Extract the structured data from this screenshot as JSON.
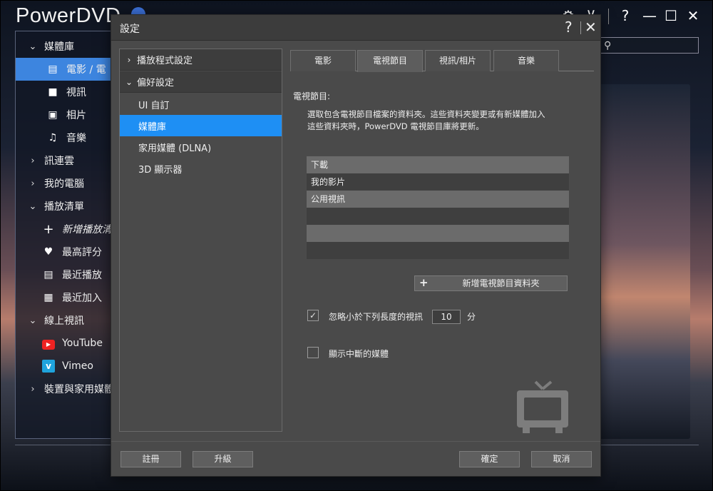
{
  "app": {
    "title": "PowerDVD",
    "window_controls": {
      "settings": "⚙",
      "minimize_tray": "⊻",
      "help": "?",
      "minimize": "—",
      "maximize": "☐",
      "close": "✕"
    }
  },
  "sidebar": {
    "items": [
      {
        "label": "媒體庫",
        "type": "section",
        "icon": "chevron-down-icon"
      },
      {
        "label": "電影 / 電",
        "type": "child",
        "icon": "film-icon",
        "selected": true
      },
      {
        "label": "視訊",
        "type": "child",
        "icon": "video-camera-icon"
      },
      {
        "label": "相片",
        "type": "child",
        "icon": "photo-icon"
      },
      {
        "label": "音樂",
        "type": "child",
        "icon": "music-note-icon"
      },
      {
        "label": "訊連雲",
        "type": "section",
        "icon": "chevron-right-icon"
      },
      {
        "label": "我的電腦",
        "type": "section",
        "icon": "chevron-right-icon"
      },
      {
        "label": "播放清單",
        "type": "section",
        "icon": "chevron-down-icon"
      },
      {
        "label": "新增播放清",
        "type": "child",
        "icon": "plus-icon",
        "italic": true
      },
      {
        "label": "最高評分",
        "type": "child",
        "icon": "heart-icon"
      },
      {
        "label": "最近播放",
        "type": "child",
        "icon": "recent-play-icon"
      },
      {
        "label": "最近加入",
        "type": "child",
        "icon": "recent-add-icon"
      },
      {
        "label": "線上視訊",
        "type": "section",
        "icon": "chevron-down-icon"
      },
      {
        "label": "YouTube",
        "type": "child",
        "icon": "youtube-icon"
      },
      {
        "label": "Vimeo",
        "type": "child",
        "icon": "vimeo-icon"
      },
      {
        "label": "裝置與家用媒體",
        "type": "section",
        "icon": "chevron-right-icon"
      }
    ]
  },
  "dialog": {
    "title": "設定",
    "help": "?",
    "close": "✕",
    "tree": {
      "player_settings": "播放程式設定",
      "preferences": "偏好設定",
      "ui_custom": "UI 自訂",
      "media_library": "媒體庫",
      "home_media": "家用媒體 (DLNA)",
      "display_3d": "3D 顯示器"
    },
    "tabs": [
      "電影",
      "電視節目",
      "視訊/相片",
      "音樂"
    ],
    "active_tab": "電視節目",
    "content": {
      "label": "電視節目:",
      "description_line1": "選取包含電視節目檔案的資料夾。這些資料夾變更或有新媒體加入",
      "description_line2": "這些資料夾時，PowerDVD 電視節目庫將更新。",
      "folders": [
        "下載",
        "我的影片",
        "公用視訊",
        "",
        "",
        ""
      ],
      "add_folder_button": "新增電視節目資料夾",
      "ignore_short_label": "忽略小於下列長度的視訊",
      "ignore_short_checked": true,
      "ignore_short_value": "10",
      "ignore_short_unit": "分",
      "show_interrupted_label": "顯示中斷的媒體",
      "show_interrupted_checked": false
    },
    "buttons": {
      "register": "註冊",
      "upgrade": "升級",
      "ok": "確定",
      "cancel": "取消"
    }
  }
}
